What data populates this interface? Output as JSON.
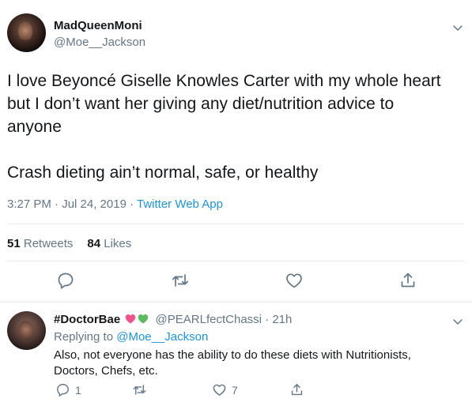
{
  "tweet": {
    "display_name": "MadQueenMoni",
    "handle": "@Moe__Jackson",
    "text_lines": [
      "I love Beyoncé Giselle Knowles Carter with my whole heart",
      "but I don’t want her giving any diet/nutrition advice to",
      "anyone"
    ],
    "text_line_2": "Crash dieting ain’t normal, safe, or healthy",
    "time": "3:27 PM · Jul 24, 2019 · ",
    "source": "Twitter Web App",
    "retweets_count": "51",
    "retweets_label": " Retweets",
    "likes_count": "84",
    "likes_label": " Likes"
  },
  "reply": {
    "display_name": "#DoctorBae",
    "handle": "@PEARLfectChassi · 21h",
    "replying_prefix": "Replying to ",
    "replying_to": "@Moe__Jackson",
    "text": "Also, not everyone has the ability to do these diets with Nutritionists, Doctors, Chefs, etc.",
    "reply_count": "1",
    "like_count": "7"
  },
  "colors": {
    "accent": "#1b95e0",
    "secondary_text": "#657786",
    "icon": "#657786",
    "divider": "#e6ecf0",
    "heart_pink": "#f4518a",
    "heart_green": "#5cb85c"
  },
  "icons": {
    "reply": "reply-icon",
    "retweet": "retweet-icon",
    "like": "heart-icon",
    "share": "share-icon",
    "menu": "chevron-down-icon"
  }
}
